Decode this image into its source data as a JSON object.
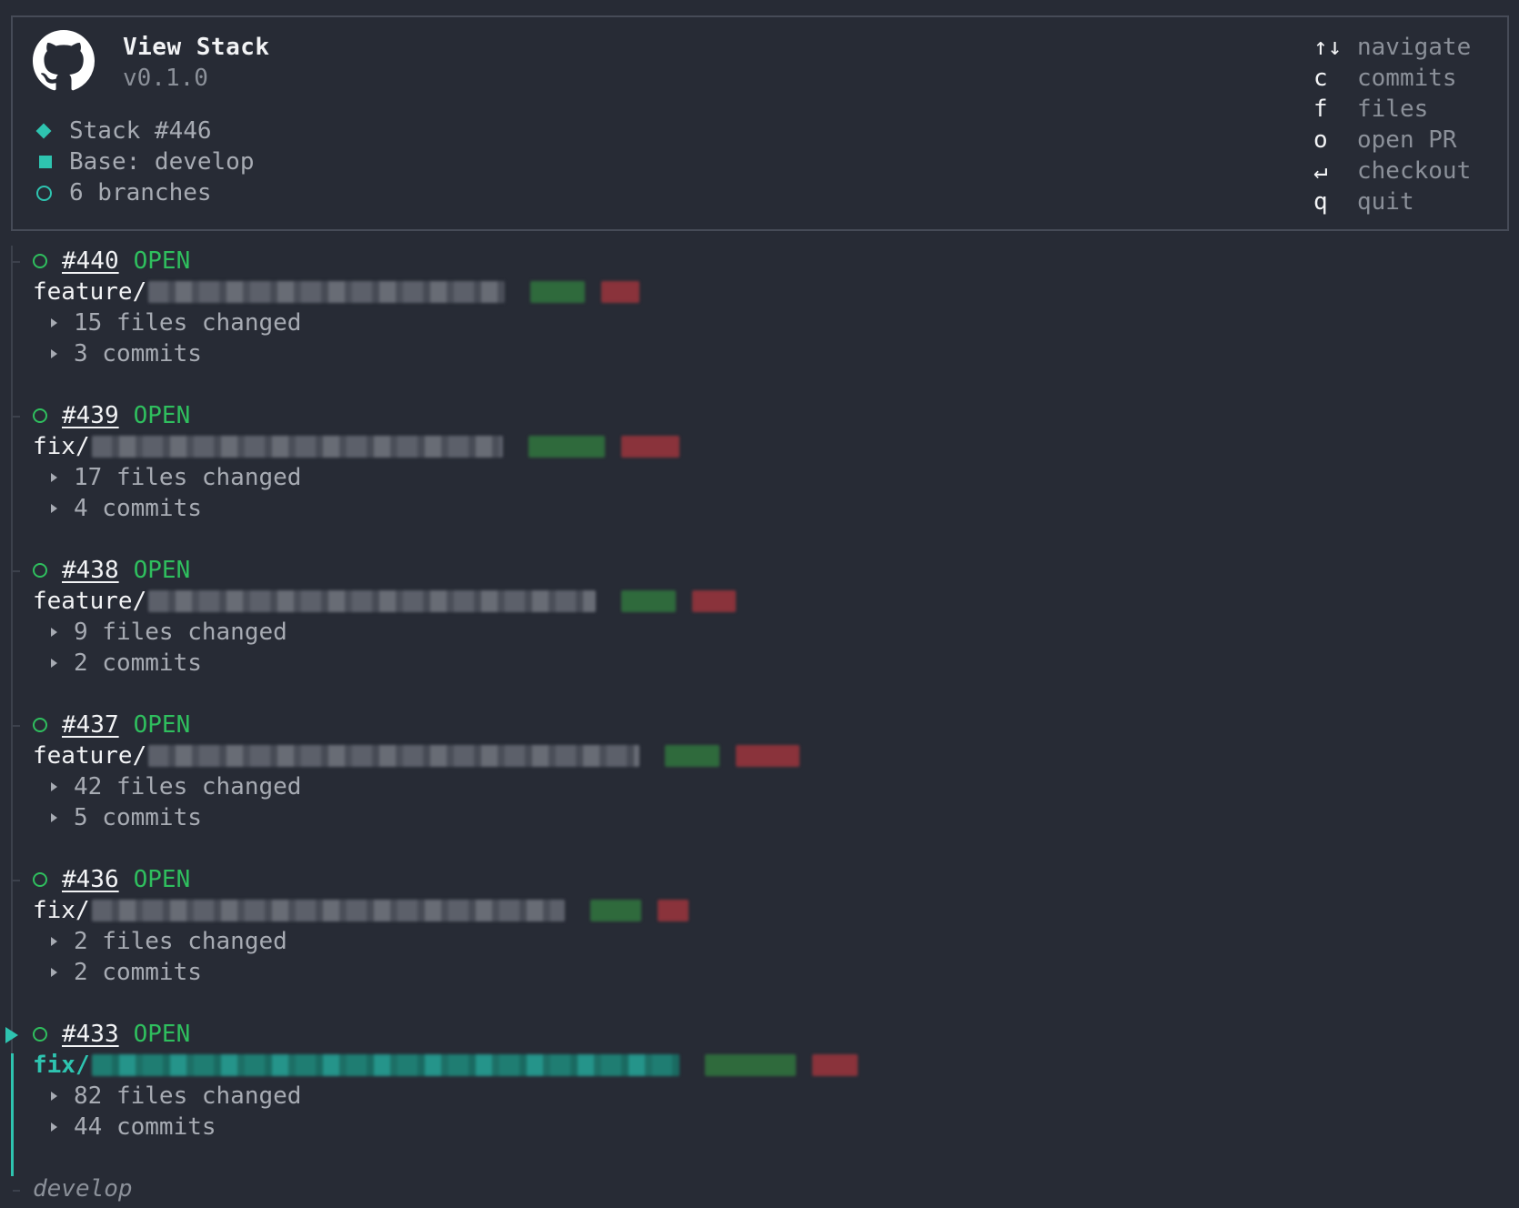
{
  "app": {
    "title": "View Stack",
    "version": "v0.1.0",
    "logo_icon": "github-icon"
  },
  "stack": {
    "id_label": "Stack #446",
    "base_label": "Base: develop",
    "branches_label": "6 branches"
  },
  "keybindings": [
    {
      "key": "↑↓",
      "label": "navigate"
    },
    {
      "key": "c",
      "label": "commits"
    },
    {
      "key": "f",
      "label": "files"
    },
    {
      "key": "o",
      "label": "open PR"
    },
    {
      "key": "↵",
      "label": "checkout"
    },
    {
      "key": "q",
      "label": "quit"
    }
  ],
  "pull_requests": [
    {
      "number": "#440",
      "state": "OPEN",
      "branch_prefix": "feature/",
      "files_changed": "15 files changed",
      "commits": "3 commits",
      "selected": false
    },
    {
      "number": "#439",
      "state": "OPEN",
      "branch_prefix": "fix/",
      "files_changed": "17 files changed",
      "commits": "4 commits",
      "selected": false
    },
    {
      "number": "#438",
      "state": "OPEN",
      "branch_prefix": "feature/",
      "files_changed": "9 files changed",
      "commits": "2 commits",
      "selected": false
    },
    {
      "number": "#437",
      "state": "OPEN",
      "branch_prefix": "feature/",
      "files_changed": "42 files changed",
      "commits": "5 commits",
      "selected": false
    },
    {
      "number": "#436",
      "state": "OPEN",
      "branch_prefix": "fix/",
      "files_changed": "2 files changed",
      "commits": "2 commits",
      "selected": false
    },
    {
      "number": "#433",
      "state": "OPEN",
      "branch_prefix": "fix/",
      "files_changed": "82 files changed",
      "commits": "44 commits",
      "selected": true
    }
  ],
  "base_branch": "develop",
  "colors": {
    "accent": "#2ec4b0",
    "open": "#2fbf5e",
    "background": "#272b35",
    "additions": "#2f6a3c",
    "deletions": "#8a333b"
  }
}
